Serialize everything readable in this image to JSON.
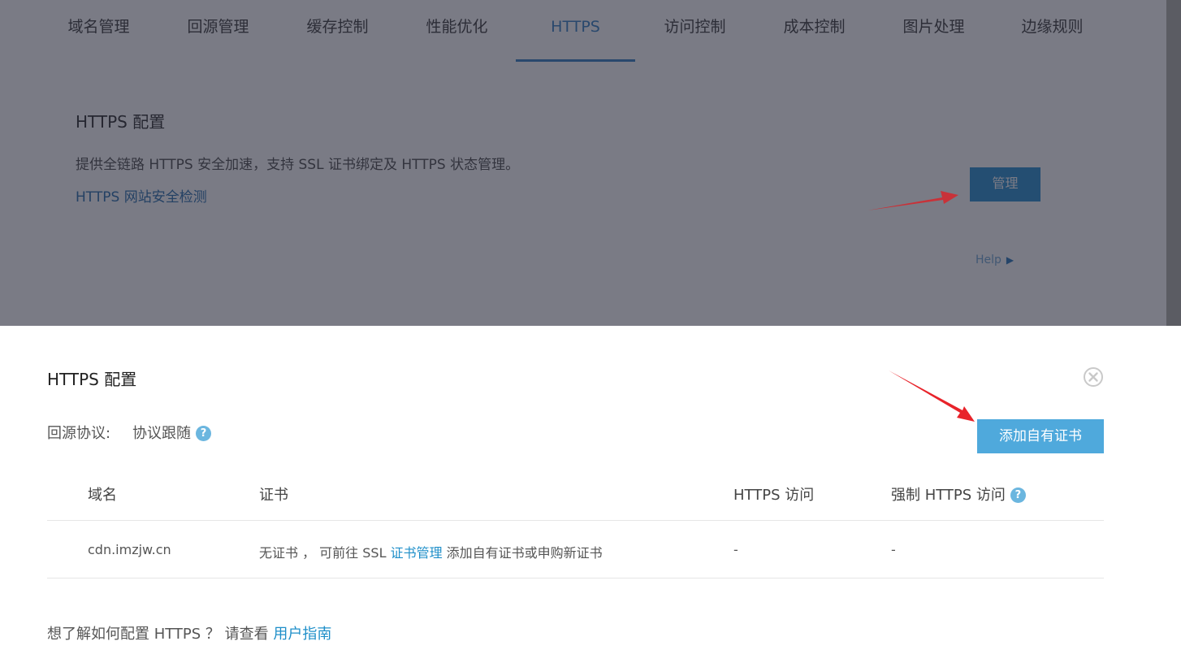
{
  "tabs": [
    {
      "label": "域名管理"
    },
    {
      "label": "回源管理"
    },
    {
      "label": "缓存控制"
    },
    {
      "label": "性能优化"
    },
    {
      "label": "HTTPS"
    },
    {
      "label": "访问控制"
    },
    {
      "label": "成本控制"
    },
    {
      "label": "图片处理"
    },
    {
      "label": "边缘规则"
    }
  ],
  "active_tab": "HTTPS",
  "section": {
    "title": "HTTPS 配置",
    "description": "提供全链路 HTTPS 安全加速，支持 SSL 证书绑定及 HTTPS 状态管理。",
    "link": "HTTPS 网站安全检测",
    "manage_button": "管理",
    "help": "Help"
  },
  "modal": {
    "title": "HTTPS 配置",
    "protocol_label": "回源协议:",
    "protocol_value": "协议跟随",
    "add_cert_button": "添加自有证书",
    "table": {
      "headers": [
        "域名",
        "证书",
        "HTTPS 访问",
        "强制 HTTPS 访问"
      ],
      "rows": [
        {
          "domain": "cdn.imzjw.cn",
          "cert_prefix": "无证书 ， 可前往 SSL ",
          "cert_link": "证书管理",
          "cert_suffix": " 添加自有证书或申购新证书",
          "https_access": "-",
          "force_https": "-"
        }
      ]
    },
    "footer_prefix": "想了解如何配置 HTTPS ？  请查看 ",
    "footer_link": "用户指南"
  },
  "colors": {
    "active_tab": "#2a7ac0",
    "primary_button": "#4fa9dc",
    "link": "#1f8fc9",
    "overlay": "rgba(40,42,58,0.62)",
    "annotation_arrow": "#e8232a"
  },
  "icons": {
    "close": "close-circle-icon",
    "help": "question-circle-icon",
    "help_arrow": "play-triangle-icon"
  }
}
